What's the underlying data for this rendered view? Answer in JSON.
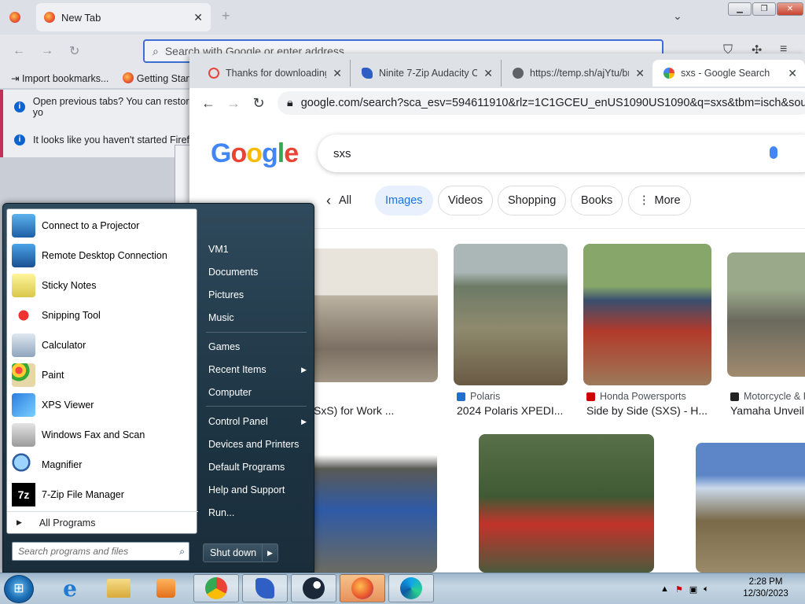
{
  "firefox": {
    "tab_title": "New Tab",
    "url_placeholder": "Search with Google or enter address",
    "bookmarks": [
      "Import bookmarks...",
      "Getting Started"
    ],
    "notices": [
      "Open previous tabs? You can restore yo",
      "It looks like you haven't started Firefox"
    ]
  },
  "chrome": {
    "tabs": [
      {
        "title": "Thanks for downloading",
        "icon_color": "#e8453c"
      },
      {
        "title": "Ninite 7-Zip Audacity C",
        "icon_color": "#2f5ec4"
      },
      {
        "title": "https://temp.sh/ajYtu/br",
        "icon_color": "#5f6368"
      },
      {
        "title": "sxs - Google Search",
        "icon_color": "#4285f4"
      }
    ],
    "url": "google.com/search?sca_esv=594611910&rlz=1C1GCEU_enUS1090US1090&q=sxs&tbm=isch&source=l"
  },
  "google": {
    "logo": "Google",
    "query": "sxs",
    "back_label": "All",
    "filters": [
      "Images",
      "Videos",
      "Shopping",
      "Books",
      "More"
    ],
    "results": [
      {
        "source": "",
        "caption": "SxS) for Work ..."
      },
      {
        "source": "Polaris",
        "caption": "2024 Polaris XPEDI..."
      },
      {
        "source": "Honda Powersports",
        "caption": "Side by Side (SXS) - H..."
      },
      {
        "source": "Motorcycle & P",
        "caption": "Yamaha Unveil"
      }
    ]
  },
  "start_menu": {
    "programs": [
      "Connect to a Projector",
      "Remote Desktop Connection",
      "Sticky Notes",
      "Snipping Tool",
      "Calculator",
      "Paint",
      "XPS Viewer",
      "Windows Fax and Scan",
      "Magnifier",
      "7-Zip File Manager"
    ],
    "all_programs": "All Programs",
    "search_placeholder": "Search programs and files",
    "right_items": [
      "VM1",
      "Documents",
      "Pictures",
      "Music",
      "Games",
      "Recent Items",
      "Computer",
      "Control Panel",
      "Devices and Printers",
      "Default Programs",
      "Help and Support",
      "Run..."
    ],
    "shutdown": "Shut down"
  },
  "taskbar": {
    "time": "2:28 PM",
    "date": "12/30/2023"
  }
}
